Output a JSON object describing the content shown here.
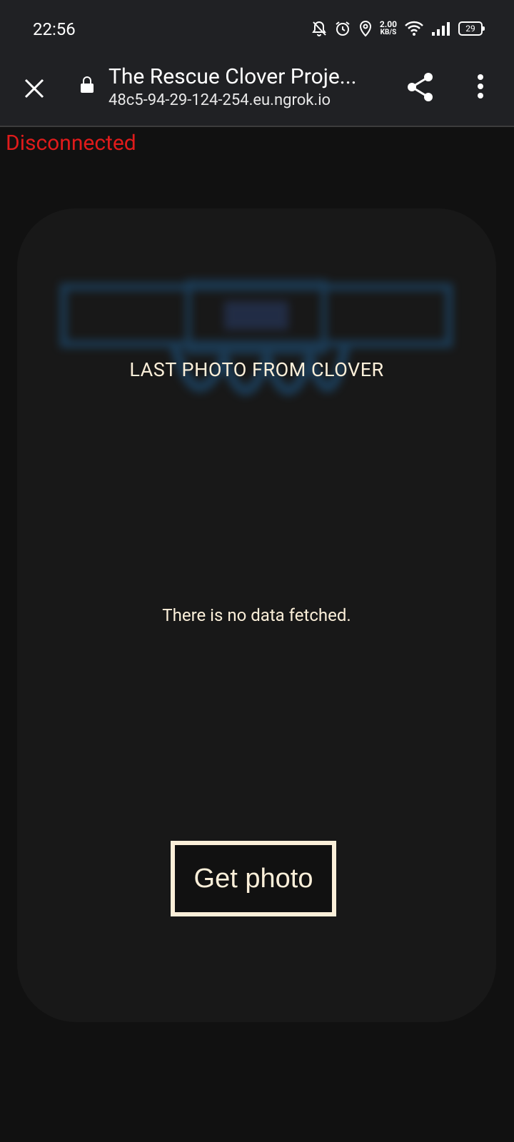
{
  "status_bar": {
    "time": "22:56",
    "net_speed": "2.00",
    "net_unit": "KB/S",
    "battery": "29"
  },
  "browser": {
    "page_title": "The Rescue Clover Proje...",
    "url": "48c5-94-29-124-254.eu.ngrok.io"
  },
  "page": {
    "connection_status": "Disconnected",
    "card_heading": "LAST PHOTO FROM CLOVER",
    "empty_message": "There is no data fetched.",
    "get_photo_label": "Get photo"
  },
  "colors": {
    "status_disconnected": "#e01b1b",
    "accent_cream": "#fbefd9",
    "card_bg": "#181818",
    "page_bg": "#111111"
  }
}
